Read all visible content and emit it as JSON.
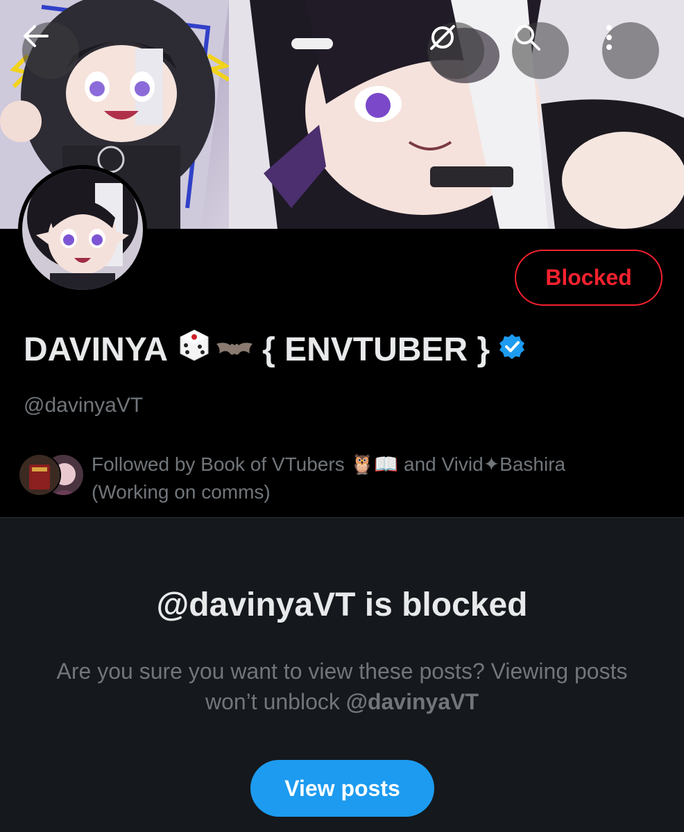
{
  "header": {
    "back_icon": "arrow-left-icon",
    "grok_icon": "circle-slash-icon",
    "search_icon": "search-icon",
    "more_icon": "more-vertical-icon"
  },
  "profile": {
    "display_name_prefix": "DAVINYA",
    "display_name_suffix": "{ ENVTUBER }",
    "emojis": [
      "dice-icon",
      "bat-icon"
    ],
    "verified_icon": "verified-badge-icon",
    "handle": "@davinyaVT",
    "blocked_label": "Blocked",
    "followed_by_line1_a": "Followed by Book of VTubers",
    "followed_by_line1_b": "and Vivid",
    "followed_by_line1_c": "Bashira",
    "followed_by_line2": "(Working on comms)"
  },
  "notice": {
    "title": "@davinyaVT is blocked",
    "body_a": "Are you sure you want to view these posts? Viewing posts won’t unblock",
    "body_handle": "@davinyaVT",
    "button_label": "View posts"
  },
  "colors": {
    "accent": "#1d9bf0",
    "blocked": "#f4212e",
    "verified": "#1d9bf0"
  }
}
